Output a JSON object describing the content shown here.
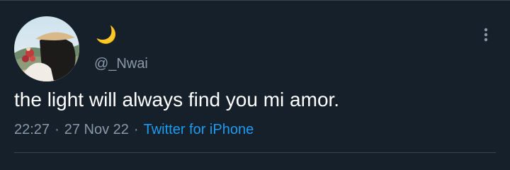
{
  "tweet": {
    "author": {
      "display_name": "🌙",
      "handle": "@_Nwai"
    },
    "text": "the light will always find you mi amor.",
    "time": "22:27",
    "date": "27 Nov 22",
    "separator": "·",
    "source": "Twitter for iPhone"
  },
  "icons": {
    "more": "more-vertical-icon"
  },
  "colors": {
    "background": "#15202b",
    "text_primary": "#ffffff",
    "text_secondary": "#8b98a5",
    "link": "#1d9bf0",
    "divider": "#38444d"
  }
}
